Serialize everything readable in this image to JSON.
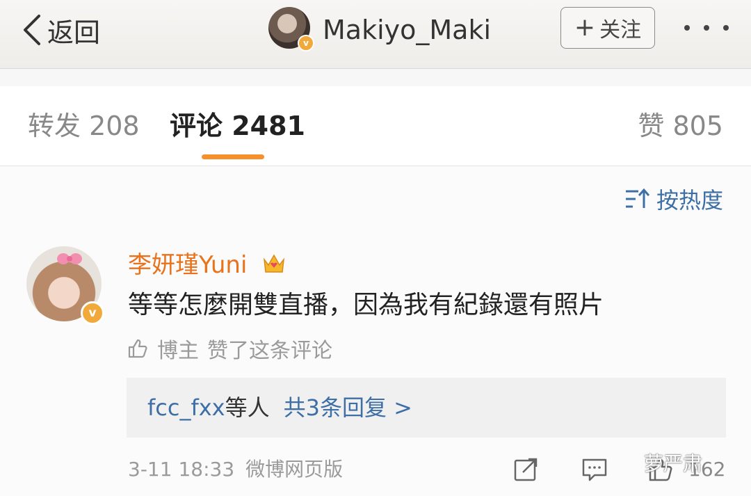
{
  "navbar": {
    "back_label": "返回",
    "title": "Makiyo_Maki",
    "follow_label": "关注",
    "verified_badge": "v"
  },
  "tabs": {
    "repost": "转发 208",
    "comments": "评论 2481",
    "likes": "赞 805"
  },
  "sort": {
    "label": "按热度"
  },
  "comment": {
    "username": "李妍瑾Yuni",
    "verified_badge": "v",
    "text": "等等怎麼開雙直播，因為我有紀錄還有照片",
    "liked_by_label": "博主",
    "liked_text": "赞了这条评论",
    "replies": {
      "user": "fcc_fxx",
      "others": "等人",
      "count_label": "共3条回复 >"
    },
    "time": "3-11 18:33",
    "source": "微博网页版",
    "like_count": "162"
  },
  "watermark": "萝严肃",
  "colors": {
    "accent_orange": "#f5902b",
    "username_orange": "#e8731c",
    "link_blue": "#3d6fa6",
    "verified_gold": "#f2a93b"
  },
  "icons": [
    "chevron-left-icon",
    "plus-icon",
    "more-dots-icon",
    "sort-icon",
    "crown-vip-icon",
    "thumb-up-icon",
    "share-icon",
    "comment-icon",
    "like-icon"
  ]
}
